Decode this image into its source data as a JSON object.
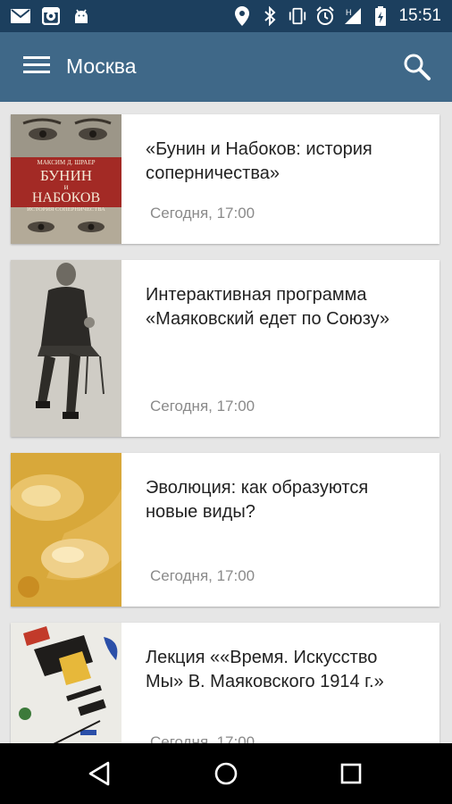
{
  "status_bar": {
    "time": "15:51",
    "icons_left": [
      "mail-icon",
      "instagram-icon",
      "android-icon"
    ],
    "icons_right": [
      "location-icon",
      "bluetooth-icon",
      "vibrate-icon",
      "alarm-icon",
      "signal-icon",
      "battery-icon"
    ]
  },
  "app_bar": {
    "title": "Москва",
    "menu_icon": "menu-icon",
    "search_icon": "search-icon",
    "background": "#3f6888"
  },
  "events": [
    {
      "title": "«Бунин и Набоков: история соперничества»",
      "date": "Сегодня, 17:00"
    },
    {
      "title": "Интерактивная программа «Маяковский едет по Союзу»",
      "date": "Сегодня, 17:00"
    },
    {
      "title": "Эволюция: как образуются новые виды?",
      "date": "Сегодня, 17:00"
    },
    {
      "title": "Лекция ««Время. Искусство Мы» В. Маяковского 1914 г.»",
      "date": "Сегодня, 17:00"
    }
  ],
  "book_cover": {
    "author": "МАКСИМ Д. ШРАЕР",
    "line1": "БУНИН",
    "line2": "и",
    "line3": "НАБОКОВ",
    "subtitle": "ИСТОРИЯ СОПЕРНИЧЕСТВА"
  },
  "nav_bar": [
    "back-icon",
    "home-icon",
    "recents-icon"
  ]
}
